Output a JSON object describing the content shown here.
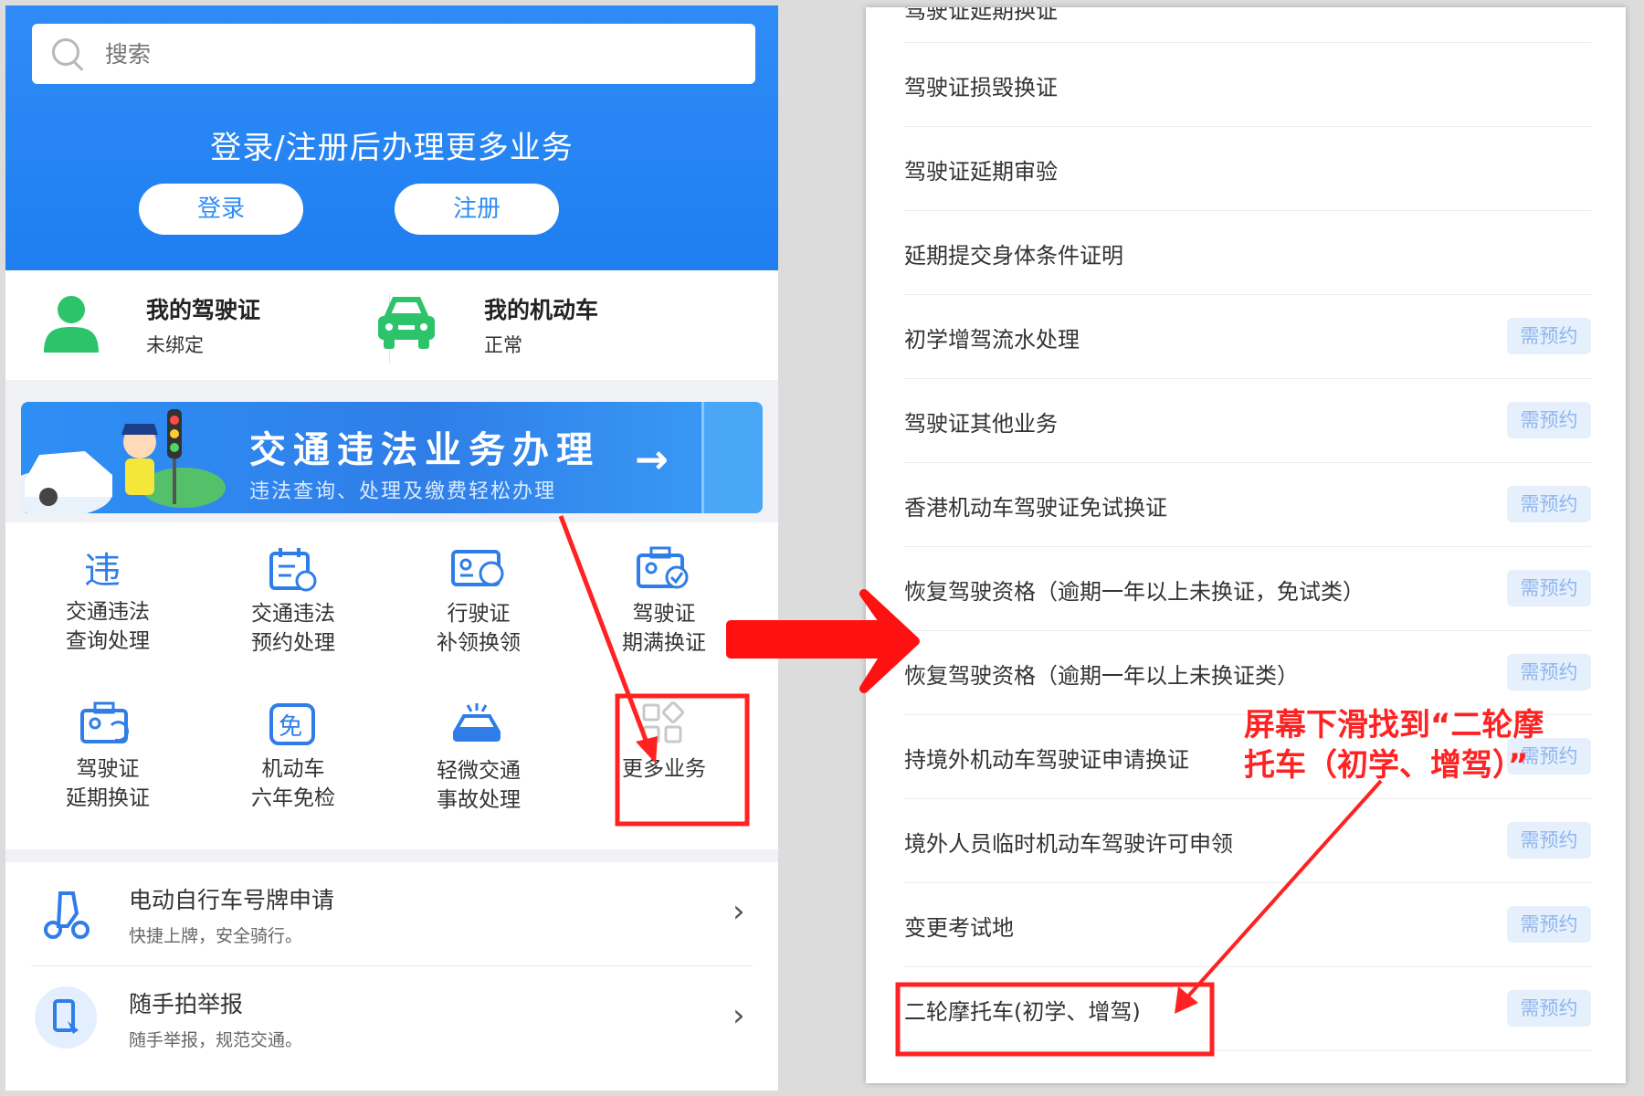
{
  "left": {
    "search_placeholder": "搜索",
    "header_title": "登录/注册后办理更多业务",
    "login": "登录",
    "register": "注册",
    "cards": [
      {
        "title": "我的驾驶证",
        "sub": "未绑定"
      },
      {
        "title": "我的机动车",
        "sub": "正常"
      }
    ],
    "banner": {
      "title": "交通违法业务办理",
      "subtitle": "违法查询、处理及缴费轻松办理"
    },
    "grid": [
      {
        "l1": "交通违法",
        "l2": "查询处理",
        "icon": "violation-icon"
      },
      {
        "l1": "交通违法",
        "l2": "预约处理",
        "icon": "calendar-icon"
      },
      {
        "l1": "行驶证",
        "l2": "补领换领",
        "icon": "vehicle-license-icon"
      },
      {
        "l1": "驾驶证",
        "l2": "期满换证",
        "icon": "license-renew-icon"
      },
      {
        "l1": "驾驶证",
        "l2": "延期换证",
        "icon": "license-delay-icon"
      },
      {
        "l1": "机动车",
        "l2": "六年免检",
        "icon": "exempt-icon"
      },
      {
        "l1": "轻微交通",
        "l2": "事故处理",
        "icon": "accident-icon"
      },
      {
        "l1": "更多业务",
        "l2": "",
        "icon": "more-icon"
      }
    ],
    "list": [
      {
        "title": "电动自行车号牌申请",
        "sub": "快捷上牌，安全骑行。"
      },
      {
        "title": "随手拍举报",
        "sub": "随手举报，规范交通。"
      }
    ]
  },
  "right": {
    "top_cut": "驾驶证延期换证",
    "badge": "需预约",
    "rows": [
      {
        "label": "驾驶证损毁换证",
        "badge": false
      },
      {
        "label": "驾驶证延期审验",
        "badge": false
      },
      {
        "label": "延期提交身体条件证明",
        "badge": false
      },
      {
        "label": "初学增驾流水处理",
        "badge": true
      },
      {
        "label": "驾驶证其他业务",
        "badge": true
      },
      {
        "label": "香港机动车驾驶证免试换证",
        "badge": true
      },
      {
        "label": "恢复驾驶资格（逾期一年以上未换证，免试类）",
        "badge": true
      },
      {
        "label": "恢复驾驶资格（逾期一年以上未换证类）",
        "badge": true
      },
      {
        "label": "持境外机动车驾驶证申请换证",
        "badge": true
      },
      {
        "label": "境外人员临时机动车驾驶许可申领",
        "badge": true
      },
      {
        "label": "变更考试地",
        "badge": true
      },
      {
        "label": "二轮摩托车(初学、增驾)",
        "badge": true
      }
    ]
  },
  "annotation": {
    "line1": "屏幕下滑找到“二轮摩",
    "line2": "托车（初学、增驾）”"
  },
  "colors": {
    "primary": "#2f8cf7",
    "green": "#2cc36b",
    "annotation": "#ff2222",
    "badge_bg": "#e6f0fd"
  }
}
